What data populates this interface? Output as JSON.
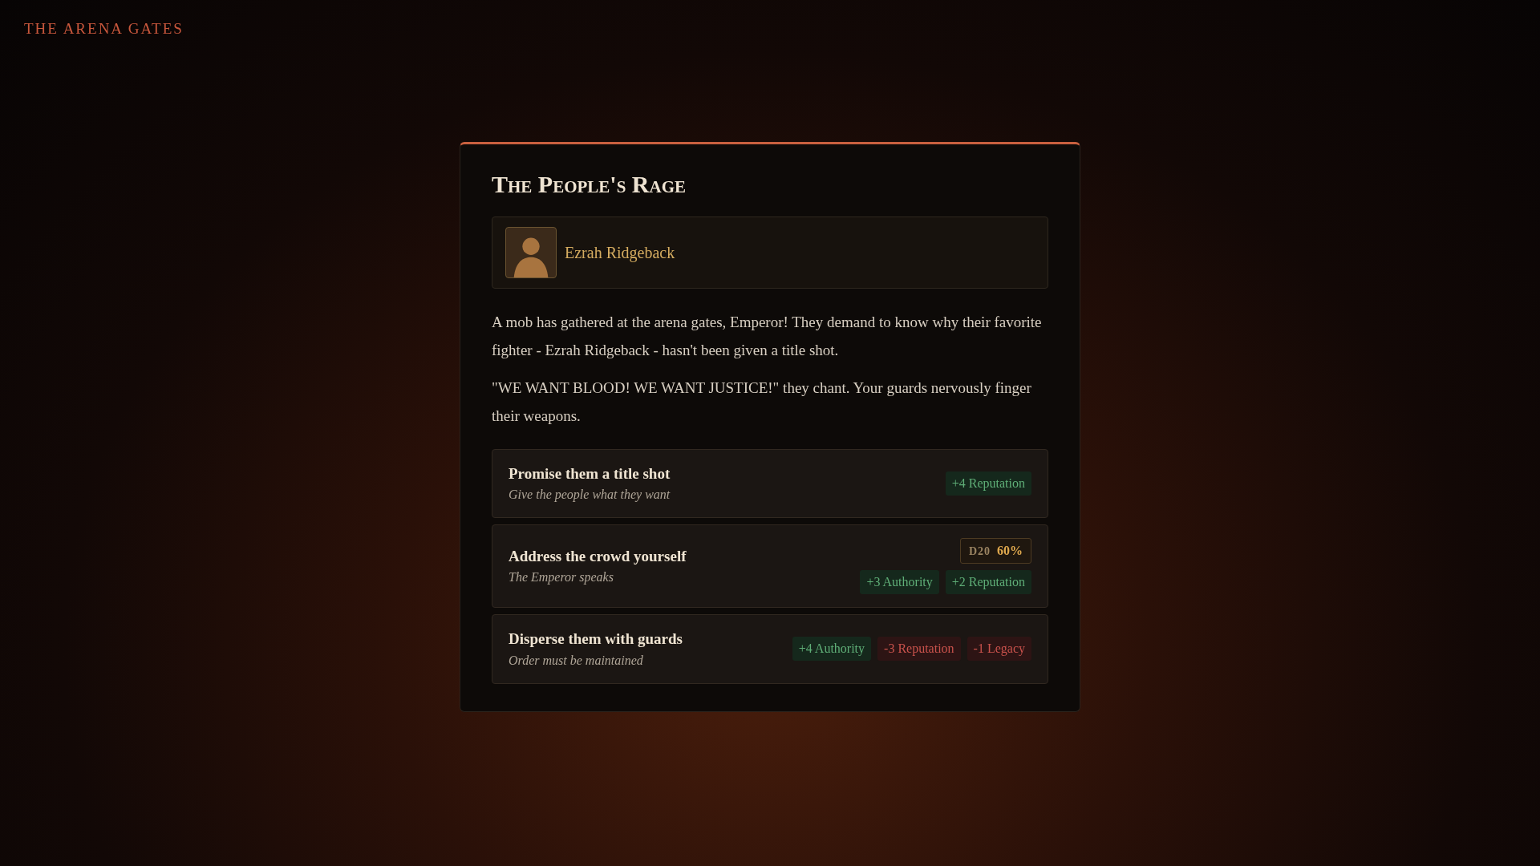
{
  "location": "THE ARENA GATES",
  "event": {
    "title": "The People's Rage",
    "character": {
      "name": "Ezrah Ridgeback"
    },
    "paragraphs": [
      "A mob has gathered at the arena gates, Emperor! They demand to know why their favorite fighter - Ezrah Ridgeback - hasn't been given a title shot.",
      "\"WE WANT BLOOD! WE WANT JUSTICE!\" they chant. Your guards nervously finger their weapons."
    ],
    "choices": [
      {
        "title": "Promise them a title shot",
        "subtitle": "Give the people what they want",
        "effects": [
          {
            "text": "+4 Reputation",
            "kind": "positive"
          }
        ]
      },
      {
        "title": "Address the crowd yourself",
        "subtitle": "The Emperor speaks",
        "check": {
          "die": "D20",
          "chance": "60%"
        },
        "effects": [
          {
            "text": "+3 Authority",
            "kind": "positive"
          },
          {
            "text": "+2 Reputation",
            "kind": "positive"
          }
        ]
      },
      {
        "title": "Disperse them with guards",
        "subtitle": "Order must be maintained",
        "effects": [
          {
            "text": "+4 Authority",
            "kind": "positive"
          },
          {
            "text": "-3 Reputation",
            "kind": "negative"
          },
          {
            "text": "-1 Legacy",
            "kind": "negative"
          }
        ]
      }
    ]
  }
}
